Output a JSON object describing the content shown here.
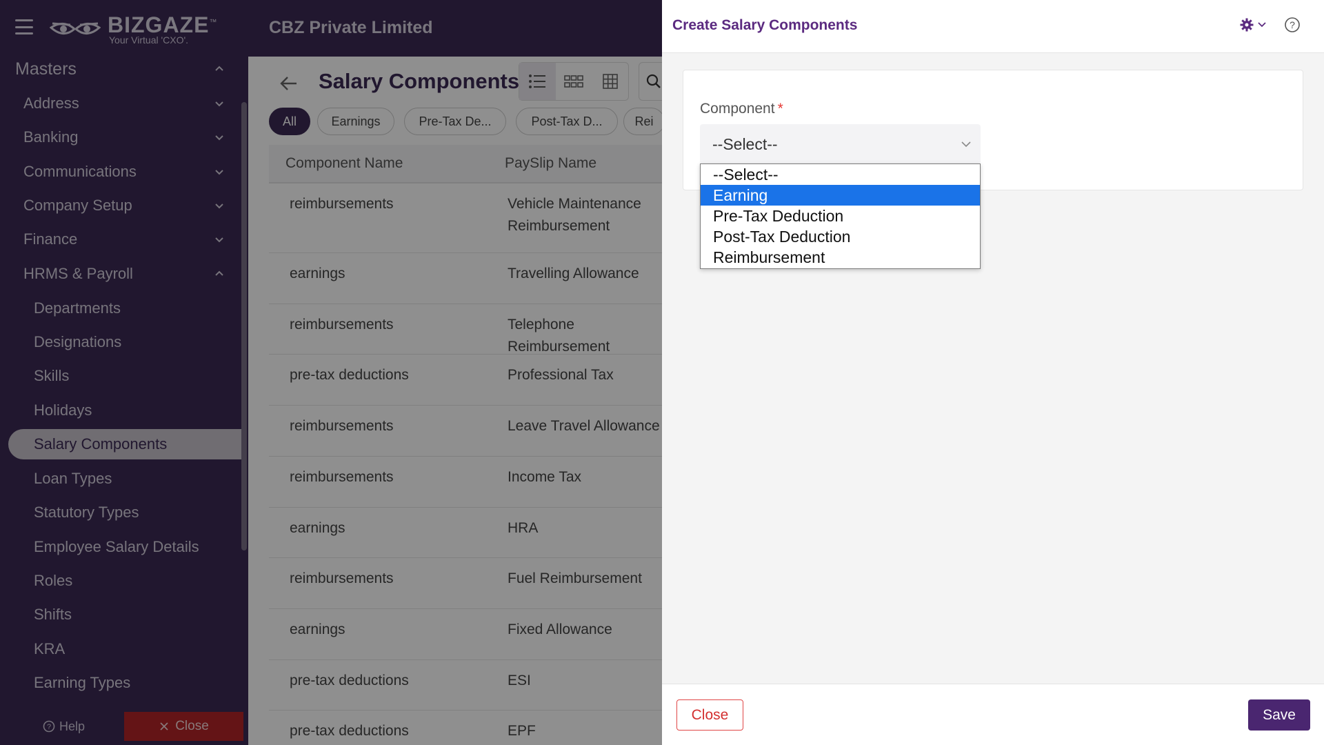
{
  "header": {
    "brand_main": "BIZGAZE",
    "brand_tm": "™",
    "brand_sub": "Your Virtual 'CXO'.",
    "company": "CBZ Private Limited"
  },
  "sidebar": {
    "items": [
      {
        "label": "Masters",
        "type": "section",
        "chevron": "up"
      },
      {
        "label": "Address",
        "type": "group",
        "chevron": "down"
      },
      {
        "label": "Banking",
        "type": "group",
        "chevron": "down"
      },
      {
        "label": "Communications",
        "type": "group",
        "chevron": "down"
      },
      {
        "label": "Company Setup",
        "type": "group",
        "chevron": "down"
      },
      {
        "label": "Finance",
        "type": "group",
        "chevron": "down"
      },
      {
        "label": "HRMS & Payroll",
        "type": "group",
        "chevron": "up"
      },
      {
        "label": "Departments",
        "type": "sub"
      },
      {
        "label": "Designations",
        "type": "sub"
      },
      {
        "label": "Skills",
        "type": "sub"
      },
      {
        "label": "Holidays",
        "type": "sub"
      },
      {
        "label": "Salary Components",
        "type": "sub",
        "active": true
      },
      {
        "label": "Loan Types",
        "type": "sub"
      },
      {
        "label": "Statutory Types",
        "type": "sub"
      },
      {
        "label": "Employee Salary Details",
        "type": "sub"
      },
      {
        "label": "Roles",
        "type": "sub"
      },
      {
        "label": "Shifts",
        "type": "sub"
      },
      {
        "label": "KRA",
        "type": "sub"
      },
      {
        "label": "Earning Types",
        "type": "sub"
      }
    ],
    "help_label": "Help",
    "close_label": "Close"
  },
  "main": {
    "title": "Salary Components",
    "filters": [
      "All",
      "Earnings",
      "Pre-Tax De...",
      "Post-Tax D...",
      "Rei"
    ],
    "columns": [
      "Component Name",
      "PaySlip Name"
    ],
    "rows": [
      {
        "component": "reimbursements",
        "payslip": "Vehicle Maintenance Reimbursement"
      },
      {
        "component": "earnings",
        "payslip": "Travelling Allowance"
      },
      {
        "component": "reimbursements",
        "payslip": "Telephone Reimbursement"
      },
      {
        "component": "pre-tax deductions",
        "payslip": "Professional Tax"
      },
      {
        "component": "reimbursements",
        "payslip": "Leave Travel Allowance"
      },
      {
        "component": "reimbursements",
        "payslip": "Income Tax"
      },
      {
        "component": "earnings",
        "payslip": "HRA"
      },
      {
        "component": "reimbursements",
        "payslip": "Fuel Reimbursement"
      },
      {
        "component": "earnings",
        "payslip": "Fixed Allowance"
      },
      {
        "component": "pre-tax deductions",
        "payslip": "ESI"
      },
      {
        "component": "pre-tax deductions",
        "payslip": "EPF"
      }
    ]
  },
  "panel": {
    "title": "Create Salary Components",
    "field_label": "Component",
    "required_mark": "*",
    "select_value": "--Select--",
    "options": [
      "--Select--",
      "Earning",
      "Pre-Tax Deduction",
      "Post-Tax Deduction",
      "Reimbursement"
    ],
    "highlighted_option": "Earning",
    "close_label": "Close",
    "save_label": "Save"
  },
  "colors": {
    "brand_dark": "#3c2a54",
    "title_purple": "#5b2a80",
    "save_bg": "#4a2670",
    "close_red": "#b32428",
    "option_highlight": "#1a73e8"
  },
  "icons": [
    "hamburger-icon",
    "chevron-up-icon",
    "chevron-down-icon",
    "back-arrow-icon",
    "list-view-icon",
    "card-view-icon",
    "grid-view-icon",
    "search-icon",
    "gear-icon",
    "help-circle-icon",
    "close-x-icon"
  ]
}
